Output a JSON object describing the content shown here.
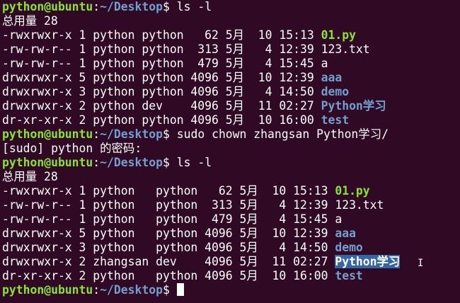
{
  "prompt": {
    "user_host": "python@ubuntu",
    "sep": ":",
    "path": "~/Desktop",
    "dollar": "$ "
  },
  "lines": [
    {
      "type": "prompt",
      "cmd": "ls -l"
    },
    {
      "type": "text",
      "text": "总用量 28"
    },
    {
      "type": "entry",
      "meta": "-rwxrwxr-x 1 python python   62 5月  10 15:13 ",
      "name": "01.py",
      "kind": "exec"
    },
    {
      "type": "entry",
      "meta": "-rw-rw-r-- 1 python python  313 5月   4 12:39 ",
      "name": "123.txt",
      "kind": "file"
    },
    {
      "type": "entry",
      "meta": "-rw-rw-r-- 1 python python  479 5月   4 15:45 ",
      "name": "a",
      "kind": "file"
    },
    {
      "type": "entry",
      "meta": "drwxrwxr-x 5 python python 4096 5月  10 12:39 ",
      "name": "aaa",
      "kind": "dir"
    },
    {
      "type": "entry",
      "meta": "drwxrwxr-x 3 python python 4096 5月   4 14:50 ",
      "name": "demo",
      "kind": "dir"
    },
    {
      "type": "entry",
      "meta": "drwxrwxr-x 2 python dev    4096 5月  11 02:27 ",
      "name": "Python学习",
      "kind": "dir"
    },
    {
      "type": "entry",
      "meta": "dr-xr-xr-x 2 python python 4096 5月  10 16:00 ",
      "name": "test",
      "kind": "dir"
    },
    {
      "type": "prompt",
      "cmd": "sudo chown zhangsan Python学习/"
    },
    {
      "type": "text",
      "text": "[sudo] python 的密码:"
    },
    {
      "type": "prompt",
      "cmd": "ls -l"
    },
    {
      "type": "text",
      "text": "总用量 28"
    },
    {
      "type": "entry",
      "meta": "-rwxrwxr-x 1 python   python   62 5月  10 15:13 ",
      "name": "01.py",
      "kind": "exec"
    },
    {
      "type": "entry",
      "meta": "-rw-rw-r-- 1 python   python  313 5月   4 12:39 ",
      "name": "123.txt",
      "kind": "file"
    },
    {
      "type": "entry",
      "meta": "-rw-rw-r-- 1 python   python  479 5月   4 15:45 ",
      "name": "a",
      "kind": "file"
    },
    {
      "type": "entry",
      "meta": "drwxrwxr-x 5 python   python 4096 5月  10 12:39 ",
      "name": "aaa",
      "kind": "dir"
    },
    {
      "type": "entry",
      "meta": "drwxrwxr-x 3 python   python 4096 5月   4 14:50 ",
      "name": "demo",
      "kind": "dir"
    },
    {
      "type": "entry",
      "meta": "drwxrwxr-x 2 zhangsan dev    4096 5月  11 02:27 ",
      "name": "Python学习",
      "kind": "dir-selected"
    },
    {
      "type": "entry",
      "meta": "dr-xr-xr-x 2 python   python 4096 5月  10 16:00 ",
      "name": "test",
      "kind": "dir"
    },
    {
      "type": "prompt",
      "cmd": "",
      "cursor": true
    }
  ],
  "colors": {
    "background": "#300a24",
    "user": "#8ae234",
    "path": "#729fcf",
    "selection": "#3465a4"
  }
}
